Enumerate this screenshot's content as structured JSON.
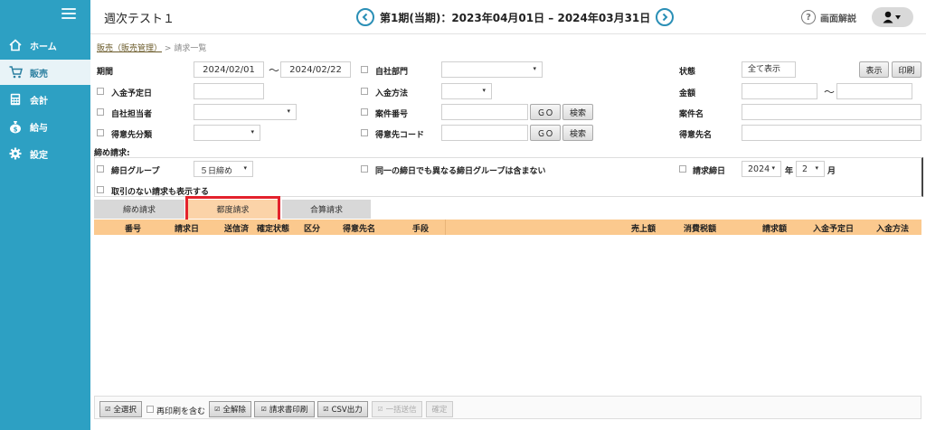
{
  "header": {
    "title": "週次テスト１",
    "period": "第1期(当期)：2023年04月01日 – 2024年03月31日",
    "help_label": "画面解説"
  },
  "sidebar": {
    "items": [
      {
        "label": "ホーム",
        "icon": "home-icon"
      },
      {
        "label": "販売",
        "icon": "cart-icon"
      },
      {
        "label": "会計",
        "icon": "calculator-icon"
      },
      {
        "label": "給与",
        "icon": "money-bag-icon"
      },
      {
        "label": "設定",
        "icon": "gear-icon"
      }
    ]
  },
  "breadcrumb": {
    "link": "販売（販売管理）",
    "separator": ">",
    "current": "請求一覧"
  },
  "filters": {
    "period_label": "期間",
    "period_from": "2024/02/01",
    "period_to": "2024/02/22",
    "tilde": "〜",
    "dept_label": "自社部門",
    "status_label": "状態",
    "status_value": "全て表示",
    "show_btn": "表示",
    "print_btn": "印刷",
    "due_date_label": "入金予定日",
    "payment_method_label": "入金方法",
    "amount_label": "金額",
    "staff_label": "自社担当者",
    "case_no_label": "案件番号",
    "go_label": "ＧＯ",
    "search_label": "検索",
    "case_name_label": "案件名",
    "customer_class_label": "得意先分類",
    "customer_code_label": "得意先コード",
    "customer_name_label": "得意先名"
  },
  "closing": {
    "section_label": "締め請求:",
    "group_label": "締日グループ",
    "group_value": "５日締め",
    "exclude_label": "同一の締日でも異なる締日グループは含まない",
    "billing_day_label": "請求締日",
    "year_value": "2024",
    "year_unit": "年",
    "month_value": "2",
    "month_unit": "月",
    "show_no_txn_label": "取引のない請求も表示する"
  },
  "tabs": [
    {
      "label": "締め請求",
      "active": false
    },
    {
      "label": "都度請求",
      "active": true
    },
    {
      "label": "合算請求",
      "active": false
    }
  ],
  "table": {
    "columns": [
      "番号",
      "請求日",
      "送信済",
      "確定状態",
      "区分",
      "得意先名",
      "手段",
      "売上額",
      "消費税額",
      "請求額",
      "入金予定日",
      "入金方法"
    ],
    "rows": []
  },
  "footer": {
    "select_all": "全選択",
    "include_printed": "再印刷を含む",
    "deselect_all": "全解除",
    "print_invoice": "請求書印刷",
    "csv_export": "CSV出力",
    "bulk_send": "一括送信",
    "confirm": "確定"
  },
  "colors": {
    "sidebar": "#2da0c3",
    "table_header": "#fbc98e",
    "active_tab": "#fbd3a8",
    "highlight": "#e3222c"
  }
}
